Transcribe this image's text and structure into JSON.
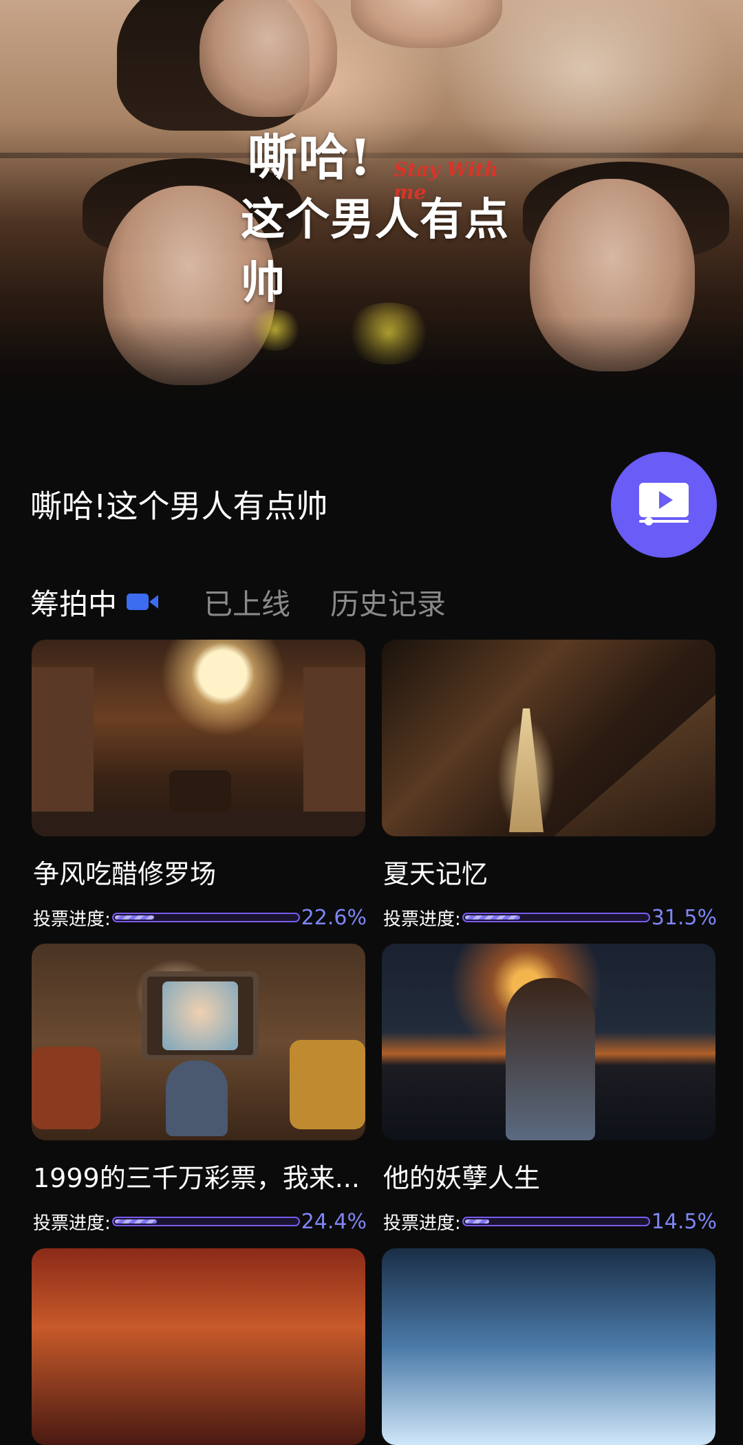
{
  "hero": {
    "art_title_line1": "嘶哈!",
    "art_title_line2": "这个男人有点帅",
    "art_title_en": "Stay With me"
  },
  "drama": {
    "title": "嘶哈!这个男人有点帅",
    "play_icon": "video-play-icon",
    "accent_color": "#6a5cf6"
  },
  "tabs": [
    {
      "label": "筹拍中",
      "icon": "video-camera-icon",
      "active": true
    },
    {
      "label": "已上线",
      "active": false
    },
    {
      "label": "历史记录",
      "active": false
    }
  ],
  "vote_label": "投票进度:",
  "cards": [
    {
      "title": "争风吃醋修罗场",
      "progress_text": "22.6%",
      "progress": 0.226
    },
    {
      "title": "夏天记忆",
      "progress_text": "31.5%",
      "progress": 0.315
    },
    {
      "title": "1999的三千万彩票，我来...",
      "progress_text": "24.4%",
      "progress": 0.244
    },
    {
      "title": "他的妖孽人生",
      "progress_text": "14.5%",
      "progress": 0.145
    }
  ],
  "colors": {
    "background": "#0b0b0b",
    "progress_border": "#7b5cf0",
    "progress_text": "#7f86f6",
    "inactive_tab": "#8a8a8a"
  }
}
